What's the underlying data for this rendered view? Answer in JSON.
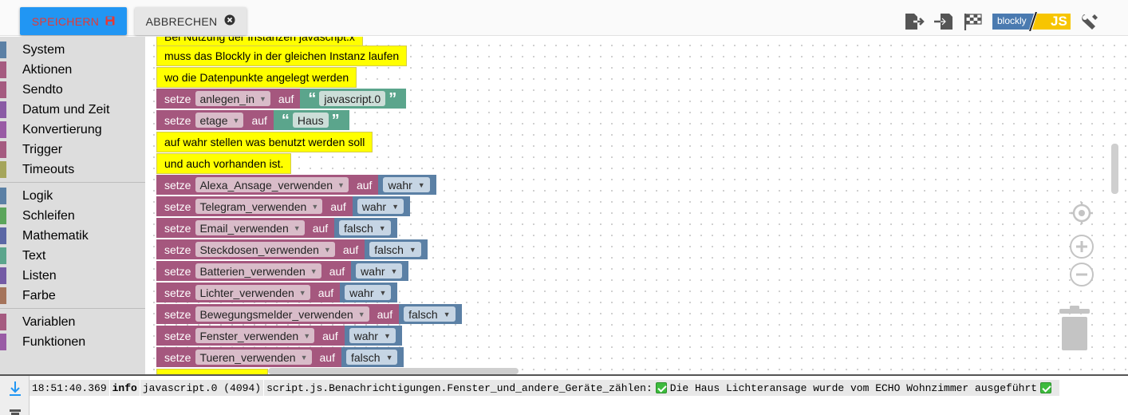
{
  "toolbar": {
    "save_label": "SPEICHERN",
    "cancel_label": "ABBRECHEN",
    "toggle_blockly_label": "blockly",
    "toggle_js_label": "JS"
  },
  "sidebar": {
    "categories": [
      {
        "label": "System",
        "color": "#5b80a5"
      },
      {
        "label": "Aktionen",
        "color": "#a55b80"
      },
      {
        "label": "Sendto",
        "color": "#a55b80"
      },
      {
        "label": "Datum und Zeit",
        "color": "#8a5ba5"
      },
      {
        "label": "Konvertierung",
        "color": "#995ba5"
      },
      {
        "label": "Trigger",
        "color": "#a55b80"
      },
      {
        "label": "Timeouts",
        "color": "#a5a55b"
      },
      {
        "label": "Logik",
        "color": "#5b80a5"
      },
      {
        "label": "Schleifen",
        "color": "#5ba55b"
      },
      {
        "label": "Mathematik",
        "color": "#5b67a5"
      },
      {
        "label": "Text",
        "color": "#5ba58c"
      },
      {
        "label": "Listen",
        "color": "#745ba5"
      },
      {
        "label": "Farbe",
        "color": "#a5745b"
      },
      {
        "label": "Variablen",
        "color": "#a55b80"
      },
      {
        "label": "Funktionen",
        "color": "#995ba5"
      }
    ]
  },
  "workspace": {
    "comments": [
      {
        "text": "Bei Nutzung der Instanzen javascript.x"
      },
      {
        "text": "muss das Blockly in der gleichen Instanz laufen"
      },
      {
        "text": "wo die Datenpunkte angelegt werden"
      },
      {
        "text": "auf wahr stellen was benutzt werden soll"
      },
      {
        "text": "und auch vorhanden ist."
      }
    ],
    "set_keyword": "setze",
    "to_keyword": "auf",
    "string_sets": [
      {
        "variable": "anlegen_in",
        "value": "javascript.0"
      },
      {
        "variable": "etage",
        "value": "Haus"
      }
    ],
    "bool_sets": [
      {
        "variable": "Alexa_Ansage_verwenden",
        "value": "wahr"
      },
      {
        "variable": "Telegram_verwenden",
        "value": "wahr"
      },
      {
        "variable": "Email_verwenden",
        "value": "falsch"
      },
      {
        "variable": "Steckdosen_verwenden",
        "value": "falsch"
      },
      {
        "variable": "Batterien_verwenden",
        "value": "wahr"
      },
      {
        "variable": "Lichter_verwenden",
        "value": "wahr"
      },
      {
        "variable": "Bewegungsmelder_verwenden",
        "value": "falsch"
      },
      {
        "variable": "Fenster_verwenden",
        "value": "wahr"
      },
      {
        "variable": "Tueren_verwenden",
        "value": "falsch"
      }
    ]
  },
  "log": {
    "time": "18:51:40.369",
    "level": "info",
    "source": "javascript.0 (4094)",
    "message_part1": "script.js.Benachrichtigungen.Fenster_und_andere_Geräte_zählen:",
    "message_part2": "Die Haus Lichteransage wurde vom ECHO Wohnzimmer ausgeführt"
  }
}
